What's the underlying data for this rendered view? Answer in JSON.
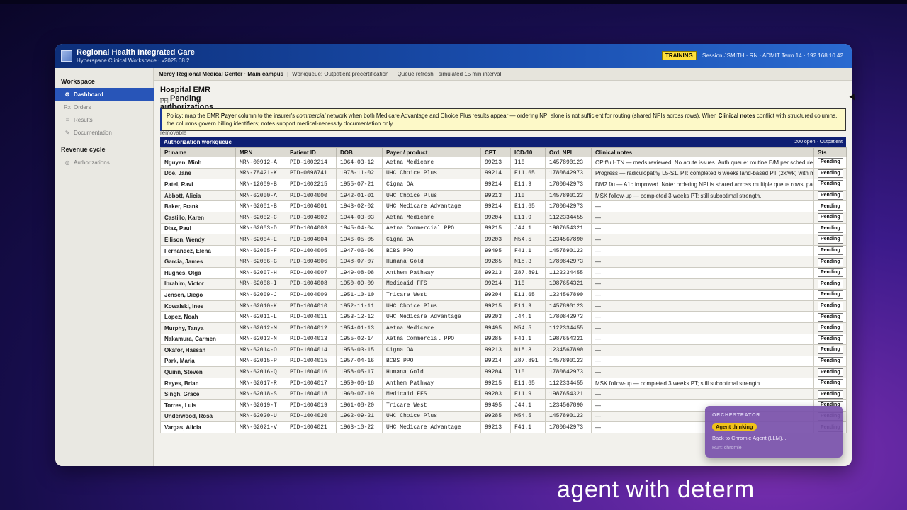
{
  "app": {
    "title": "Regional Health Integrated Care",
    "subtitle": "Hyperspace Clinical Workspace · v2025.08.2",
    "training_badge": "TRAINING",
    "session": "Session JSMITH · RN · ADMIT   Term 14 · 192.168.10.42"
  },
  "sidebar": {
    "workspace_heading": "Workspace",
    "workspace_items": [
      {
        "icon": "⚙",
        "label": "Dashboard"
      },
      {
        "icon": "Rx",
        "label": "Orders"
      },
      {
        "icon": "≡",
        "label": "Results"
      },
      {
        "icon": "✎",
        "label": "Documentation"
      }
    ],
    "revenue_heading": "Revenue cycle",
    "revenue_items": [
      {
        "icon": "◎",
        "label": "Authorizations"
      }
    ]
  },
  "infobar": {
    "facility": "Mercy Regional Medical Center · Main campus",
    "workqueue": "Workqueue: Outpatient precertification",
    "refresh": "Queue refresh · simulated 15 min interval"
  },
  "page": {
    "title": "Hospital EMR — Pending authorizations",
    "subtitle": "PHI · Internal use only · Do not copy to removable media. Activity may be audited per IS policy 4400."
  },
  "policy": {
    "p1": "Policy: map the EMR ",
    "b1": "Payer",
    "p2": " column to the insurer's ",
    "i1": "commercial",
    "p3": " network when both Medicare Advantage and Choice Plus results appear — ordering NPI alone is not sufficient for routing (shared NPIs across rows). When ",
    "b2": "Clinical notes",
    "p4": " conflict with structured columns, the columns govern billing identifiers; notes support medical-necessity documentation only."
  },
  "workqueue": {
    "title": "Authorization workqueue",
    "count": "200 open · Outpatient",
    "columns": [
      "Pt name",
      "MRN",
      "Patient ID",
      "DOB",
      "Payer / product",
      "CPT",
      "ICD-10",
      "Ord. NPI",
      "Clinical notes",
      "Sts"
    ],
    "rows": [
      [
        "Nguyen, Minh",
        "MRN-00912-A",
        "PID-1002214",
        "1964-03-12",
        "Aetna Medicare",
        "99213",
        "I10",
        "1457890123",
        "OP f/u HTN — meds reviewed. No acute issues. Auth queue: routine E/M per schedule. (Structured row i",
        "Pending"
      ],
      [
        "Doe, Jane",
        "MRN-78421-K",
        "PID-0098741",
        "1978-11-02",
        "UHC Choice Plus",
        "99214",
        "E11.65",
        "1780842973",
        "Progress — radiculopathy L5-S1. PT: completed 6 weeks land-based PT (2x/wk) with modest fu",
        "Pending"
      ],
      [
        "Patel, Ravi",
        "MRN-12009-B",
        "PID-1002215",
        "1955-07-21",
        "Cigna OA",
        "99214",
        "E11.9",
        "1780842973",
        "DM2 f/u — A1c improved. Note: ordering NPI is shared across multiple queue rows; payer colu",
        "Pending"
      ],
      [
        "Abbott, Alicia",
        "MRN-62000-A",
        "PID-1004000",
        "1942-01-01",
        "UHC Choice Plus",
        "99213",
        "I10",
        "1457890123",
        "MSK follow-up — completed 3 weeks PT; still suboptimal strength.",
        "Pending"
      ],
      [
        "Baker, Frank",
        "MRN-62001-B",
        "PID-1004001",
        "1943-02-02",
        "UHC Medicare Advantage",
        "99214",
        "E11.65",
        "1780842973",
        "—",
        "Pending"
      ],
      [
        "Castillo, Karen",
        "MRN-62002-C",
        "PID-1004002",
        "1944-03-03",
        "Aetna Medicare",
        "99204",
        "E11.9",
        "1122334455",
        "—",
        "Pending"
      ],
      [
        "Diaz, Paul",
        "MRN-62003-D",
        "PID-1004003",
        "1945-04-04",
        "Aetna Commercial PPO",
        "99215",
        "J44.1",
        "1987654321",
        "—",
        "Pending"
      ],
      [
        "Ellison, Wendy",
        "MRN-62004-E",
        "PID-1004004",
        "1946-05-05",
        "Cigna OA",
        "99203",
        "M54.5",
        "1234567890",
        "—",
        "Pending"
      ],
      [
        "Fernandez, Elena",
        "MRN-62005-F",
        "PID-1004005",
        "1947-06-06",
        "BCBS PPO",
        "99495",
        "F41.1",
        "1457890123",
        "—",
        "Pending"
      ],
      [
        "Garcia, James",
        "MRN-62006-G",
        "PID-1004006",
        "1948-07-07",
        "Humana Gold",
        "99285",
        "N18.3",
        "1780842973",
        "—",
        "Pending"
      ],
      [
        "Hughes, Olga",
        "MRN-62007-H",
        "PID-1004007",
        "1949-08-08",
        "Anthem Pathway",
        "99213",
        "Z87.891",
        "1122334455",
        "—",
        "Pending"
      ],
      [
        "Ibrahim, Victor",
        "MRN-62008-I",
        "PID-1004008",
        "1950-09-09",
        "Medicaid FFS",
        "99214",
        "I10",
        "1987654321",
        "—",
        "Pending"
      ],
      [
        "Jensen, Diego",
        "MRN-62009-J",
        "PID-1004009",
        "1951-10-10",
        "Tricare West",
        "99204",
        "E11.65",
        "1234567890",
        "—",
        "Pending"
      ],
      [
        "Kowalski, Ines",
        "MRN-62010-K",
        "PID-1004010",
        "1952-11-11",
        "UHC Choice Plus",
        "99215",
        "E11.9",
        "1457890123",
        "—",
        "Pending"
      ],
      [
        "Lopez, Noah",
        "MRN-62011-L",
        "PID-1004011",
        "1953-12-12",
        "UHC Medicare Advantage",
        "99203",
        "J44.1",
        "1780842973",
        "—",
        "Pending"
      ],
      [
        "Murphy, Tanya",
        "MRN-62012-M",
        "PID-1004012",
        "1954-01-13",
        "Aetna Medicare",
        "99495",
        "M54.5",
        "1122334455",
        "—",
        "Pending"
      ],
      [
        "Nakamura, Carmen",
        "MRN-62013-N",
        "PID-1004013",
        "1955-02-14",
        "Aetna Commercial PPO",
        "99285",
        "F41.1",
        "1987654321",
        "—",
        "Pending"
      ],
      [
        "Okafor, Hassan",
        "MRN-62014-O",
        "PID-1004014",
        "1956-03-15",
        "Cigna OA",
        "99213",
        "N18.3",
        "1234567890",
        "—",
        "Pending"
      ],
      [
        "Park, Maria",
        "MRN-62015-P",
        "PID-1004015",
        "1957-04-16",
        "BCBS PPO",
        "99214",
        "Z87.891",
        "1457890123",
        "—",
        "Pending"
      ],
      [
        "Quinn, Steven",
        "MRN-62016-Q",
        "PID-1004016",
        "1958-05-17",
        "Humana Gold",
        "99204",
        "I10",
        "1780842973",
        "—",
        "Pending"
      ],
      [
        "Reyes, Brian",
        "MRN-62017-R",
        "PID-1004017",
        "1959-06-18",
        "Anthem Pathway",
        "99215",
        "E11.65",
        "1122334455",
        "MSK follow-up — completed 3 weeks PT; still suboptimal strength.",
        "Pending"
      ],
      [
        "Singh, Grace",
        "MRN-62018-S",
        "PID-1004018",
        "1960-07-19",
        "Medicaid FFS",
        "99203",
        "E11.9",
        "1987654321",
        "—",
        "Pending"
      ],
      [
        "Torres, Luis",
        "MRN-62019-T",
        "PID-1004019",
        "1961-08-20",
        "Tricare West",
        "99495",
        "J44.1",
        "1234567890",
        "—",
        "Pending"
      ],
      [
        "Underwood, Rosa",
        "MRN-62020-U",
        "PID-1004020",
        "1962-09-21",
        "UHC Choice Plus",
        "99285",
        "M54.5",
        "1457890123",
        "—",
        "Pending"
      ],
      [
        "Vargas, Alicia",
        "MRN-62021-V",
        "PID-1004021",
        "1963-10-22",
        "UHC Medicare Advantage",
        "99213",
        "F41.1",
        "1780842973",
        "—",
        "Pending"
      ]
    ]
  },
  "orchestrator": {
    "heading": "ORCHESTRATOR",
    "badge": "Agent thinking",
    "message": "Back to Chromie Agent (LLM)...",
    "run": "Run: chromie"
  },
  "caption": "agent with determ",
  "colors": {
    "titlebar": "#1a4fb0",
    "active_nav": "#2855b8",
    "workqueue_header": "#0e1f73",
    "training_badge": "#ffe03a",
    "policy_bg": "#fdf9c8",
    "orchestrator_badge": "#f1c21b"
  }
}
